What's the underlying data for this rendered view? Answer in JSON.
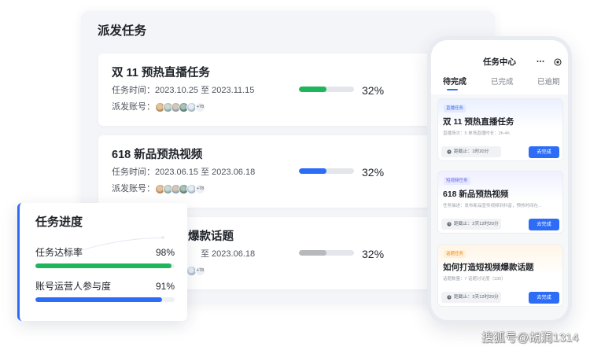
{
  "colors": {
    "primary_blue": "#2d6cf6",
    "success_green": "#1fb55d",
    "neutral_gray": "#b8b9bc"
  },
  "dispatch_panel": {
    "title": "派发任务",
    "tasks": [
      {
        "title": "双 11 预热直播任务",
        "time_text": "任务时间：2023.10.25 至 2023.11.15",
        "accounts_label": "派发账号：",
        "accounts_more": "+78",
        "progress_label": "32%",
        "progress_fill": 0.5,
        "bar_color": "#1fb55d"
      },
      {
        "title": "618 新品预热视频",
        "time_text": "任务时间：2023.06.15 至 2023.06.18",
        "accounts_label": "派发账号：",
        "accounts_more": "+78",
        "progress_label": "32%",
        "progress_fill": 0.5,
        "bar_color": "#2d6cf6"
      },
      {
        "title": "爆款话题",
        "time_text": "至 2023.06.18",
        "accounts_more": "+78",
        "progress_label": "32%",
        "progress_fill": 0.5,
        "bar_color": "#b8b9bc"
      }
    ]
  },
  "progress_panel": {
    "title": "任务进度",
    "metrics": [
      {
        "label": "任务达标率",
        "value_label": "98%",
        "fill": 0.98,
        "bar_color": "#1fb55d"
      },
      {
        "label": "账号运营人参与度",
        "value_label": "91%",
        "fill": 0.91,
        "bar_color": "#2d6cf6"
      }
    ]
  },
  "phone": {
    "header_title": "任务中心",
    "header_icons": [
      "more-icon",
      "target-icon"
    ],
    "deadline_icon": "clock-icon",
    "tabs": [
      {
        "label": "待完成",
        "active": true
      },
      {
        "label": "已完成",
        "active": false
      },
      {
        "label": "已逾期",
        "active": false
      }
    ],
    "cards": [
      {
        "tag": "直播任务",
        "tag_color": "#3b73f5",
        "tag_bg": "#e1e9ff",
        "title": "双 11 预热直播任务",
        "desc": "直播场次：5   单场直播时长：2h-4h",
        "deadline": "距截止：1时20分",
        "action_label": "去完成"
      },
      {
        "tag": "短视频任务",
        "tag_color": "#5b63ef",
        "tag_bg": "#e9e9ff",
        "title": "618 新品预热视频",
        "desc": "任务描述：发布新品宣传视频到抖音，预热时间在...",
        "deadline": "距截止：2天12时20分",
        "action_label": "去完成"
      },
      {
        "tag": "话题任务",
        "tag_color": "#ee8a17",
        "tag_bg": "#ffefd6",
        "title": "如何打造短视频爆款话题",
        "desc": "话题数量：7  话题讨论度（330）",
        "deadline": "距截止：2天12时20分",
        "action_label": "去完成"
      }
    ]
  },
  "watermark": "搜狐号@胡润1314"
}
